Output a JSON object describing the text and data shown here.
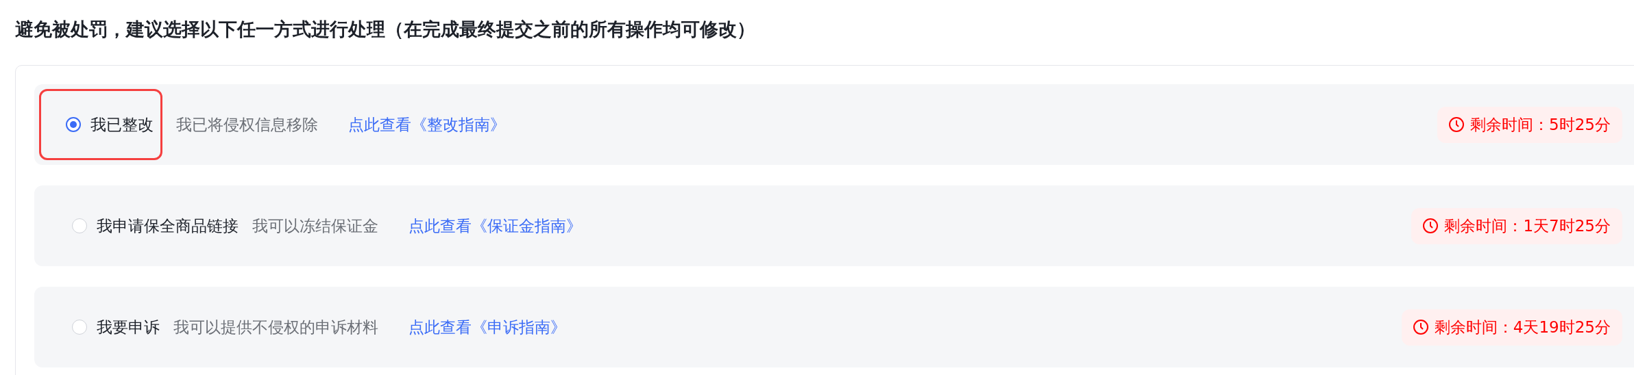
{
  "title": "避免被处罚，建议选择以下任一方式进行处理（在完成最终提交之前的所有操作均可修改）",
  "options": [
    {
      "label": "我已整改",
      "description": "我已将侵权信息移除",
      "link": "点此查看《整改指南》",
      "remaining": "剩余时间：5时25分",
      "selected": true
    },
    {
      "label": "我申请保全商品链接",
      "description": "我可以冻结保证金",
      "link": "点此查看《保证金指南》",
      "remaining": "剩余时间：1天7时25分",
      "selected": false
    },
    {
      "label": "我要申诉",
      "description": "我可以提供不侵权的申诉材料",
      "link": "点此查看《申诉指南》",
      "remaining": "剩余时间：4天19时25分",
      "selected": false
    }
  ]
}
